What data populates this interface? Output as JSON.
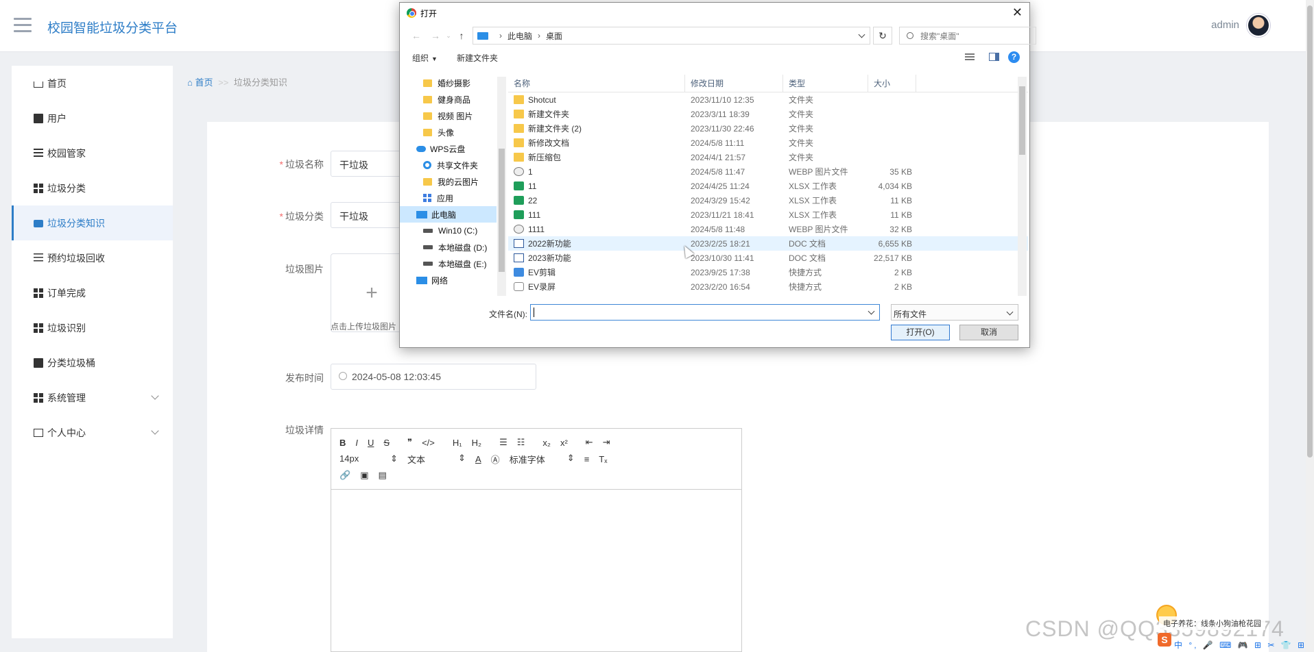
{
  "header": {
    "app_title": "校园智能垃圾分类平台",
    "user": "admin"
  },
  "sidebar": {
    "items": [
      {
        "label": "首页"
      },
      {
        "label": "用户"
      },
      {
        "label": "校园管家"
      },
      {
        "label": "垃圾分类"
      },
      {
        "label": "垃圾分类知识",
        "active": true
      },
      {
        "label": "预约垃圾回收"
      },
      {
        "label": "订单完成"
      },
      {
        "label": "垃圾识别"
      },
      {
        "label": "分类垃圾桶"
      },
      {
        "label": "系统管理"
      },
      {
        "label": "个人中心"
      }
    ]
  },
  "breadcrumb": {
    "home": "首页",
    "sep": ">>",
    "current": "垃圾分类知识"
  },
  "form": {
    "name_label": "垃圾名称",
    "name_value": "干垃圾",
    "category_label": "垃圾分类",
    "category_value": "干垃圾",
    "image_label": "垃圾图片",
    "upload_plus": "+",
    "upload_hint": "点击上传垃圾图片",
    "time_label": "发布时间",
    "time_value": "2024-05-08 12:03:45",
    "detail_label": "垃圾详情",
    "editor": {
      "font_size": "14px",
      "text_style": "文本",
      "font_family": "标准字体"
    }
  },
  "dialog": {
    "title": "打开",
    "path": [
      "此电脑",
      "桌面"
    ],
    "search_placeholder": "搜索\"桌面\"",
    "organize": "组织",
    "new_folder": "新建文件夹",
    "nav": [
      {
        "label": "婚纱摄影",
        "icon": "folder"
      },
      {
        "label": "健身商品",
        "icon": "folder"
      },
      {
        "label": "视频 图片",
        "icon": "folder"
      },
      {
        "label": "头像",
        "icon": "folder"
      },
      {
        "label": "WPS云盘",
        "icon": "cloud"
      },
      {
        "label": "共享文件夹",
        "icon": "share"
      },
      {
        "label": "我的云图片",
        "icon": "folder"
      },
      {
        "label": "应用",
        "icon": "apps"
      },
      {
        "label": "此电脑",
        "icon": "pc",
        "selected": true
      },
      {
        "label": "Win10 (C:)",
        "icon": "drive"
      },
      {
        "label": "本地磁盘 (D:)",
        "icon": "drive"
      },
      {
        "label": "本地磁盘 (E:)",
        "icon": "drive"
      },
      {
        "label": "网络",
        "icon": "network"
      }
    ],
    "columns": [
      "名称",
      "修改日期",
      "类型",
      "大小"
    ],
    "files": [
      {
        "name": "Shotcut",
        "date": "2023/11/10 12:35",
        "type": "文件夹",
        "size": "",
        "icon": "folder"
      },
      {
        "name": "新建文件夹",
        "date": "2023/3/11 18:39",
        "type": "文件夹",
        "size": "",
        "icon": "folder"
      },
      {
        "name": "新建文件夹 (2)",
        "date": "2023/11/30 22:46",
        "type": "文件夹",
        "size": "",
        "icon": "folder"
      },
      {
        "name": "新修改文档",
        "date": "2024/5/8 11:11",
        "type": "文件夹",
        "size": "",
        "icon": "folder"
      },
      {
        "name": "新压缩包",
        "date": "2024/4/1 21:57",
        "type": "文件夹",
        "size": "",
        "icon": "folder"
      },
      {
        "name": "1",
        "date": "2024/5/8 11:47",
        "type": "WEBP 图片文件",
        "size": "35 KB",
        "icon": "webp"
      },
      {
        "name": "11",
        "date": "2024/4/25 11:24",
        "type": "XLSX 工作表",
        "size": "4,034 KB",
        "icon": "xlsx"
      },
      {
        "name": "22",
        "date": "2024/3/29 15:42",
        "type": "XLSX 工作表",
        "size": "11 KB",
        "icon": "xlsx"
      },
      {
        "name": "111",
        "date": "2023/11/21 18:41",
        "type": "XLSX 工作表",
        "size": "11 KB",
        "icon": "xlsx"
      },
      {
        "name": "1111",
        "date": "2024/5/8 11:48",
        "type": "WEBP 图片文件",
        "size": "32 KB",
        "icon": "webp"
      },
      {
        "name": "2022新功能",
        "date": "2023/2/25 18:21",
        "type": "DOC 文档",
        "size": "6,655 KB",
        "icon": "doc",
        "hover": true
      },
      {
        "name": "2023新功能",
        "date": "2023/10/30 11:41",
        "type": "DOC 文档",
        "size": "22,517 KB",
        "icon": "doc"
      },
      {
        "name": "EV剪辑",
        "date": "2023/9/25 17:38",
        "type": "快捷方式",
        "size": "2 KB",
        "icon": "lnk"
      },
      {
        "name": "EV录屏",
        "date": "2023/2/20 16:54",
        "type": "快捷方式",
        "size": "2 KB",
        "icon": "lnk2"
      }
    ],
    "filename_label": "文件名(N):",
    "filename_value": "",
    "filetype": "所有文件",
    "open_button": "打开(O)",
    "cancel_button": "取消"
  },
  "overlay": {
    "watermark": "CSDN @QQ3359892174",
    "ime_tip": "电子养花：线条小狗油枪花园",
    "ime_bar": "中 °, 🎤 ⌨ 🎮 ⊞ ✂ 👕 ⊞"
  }
}
